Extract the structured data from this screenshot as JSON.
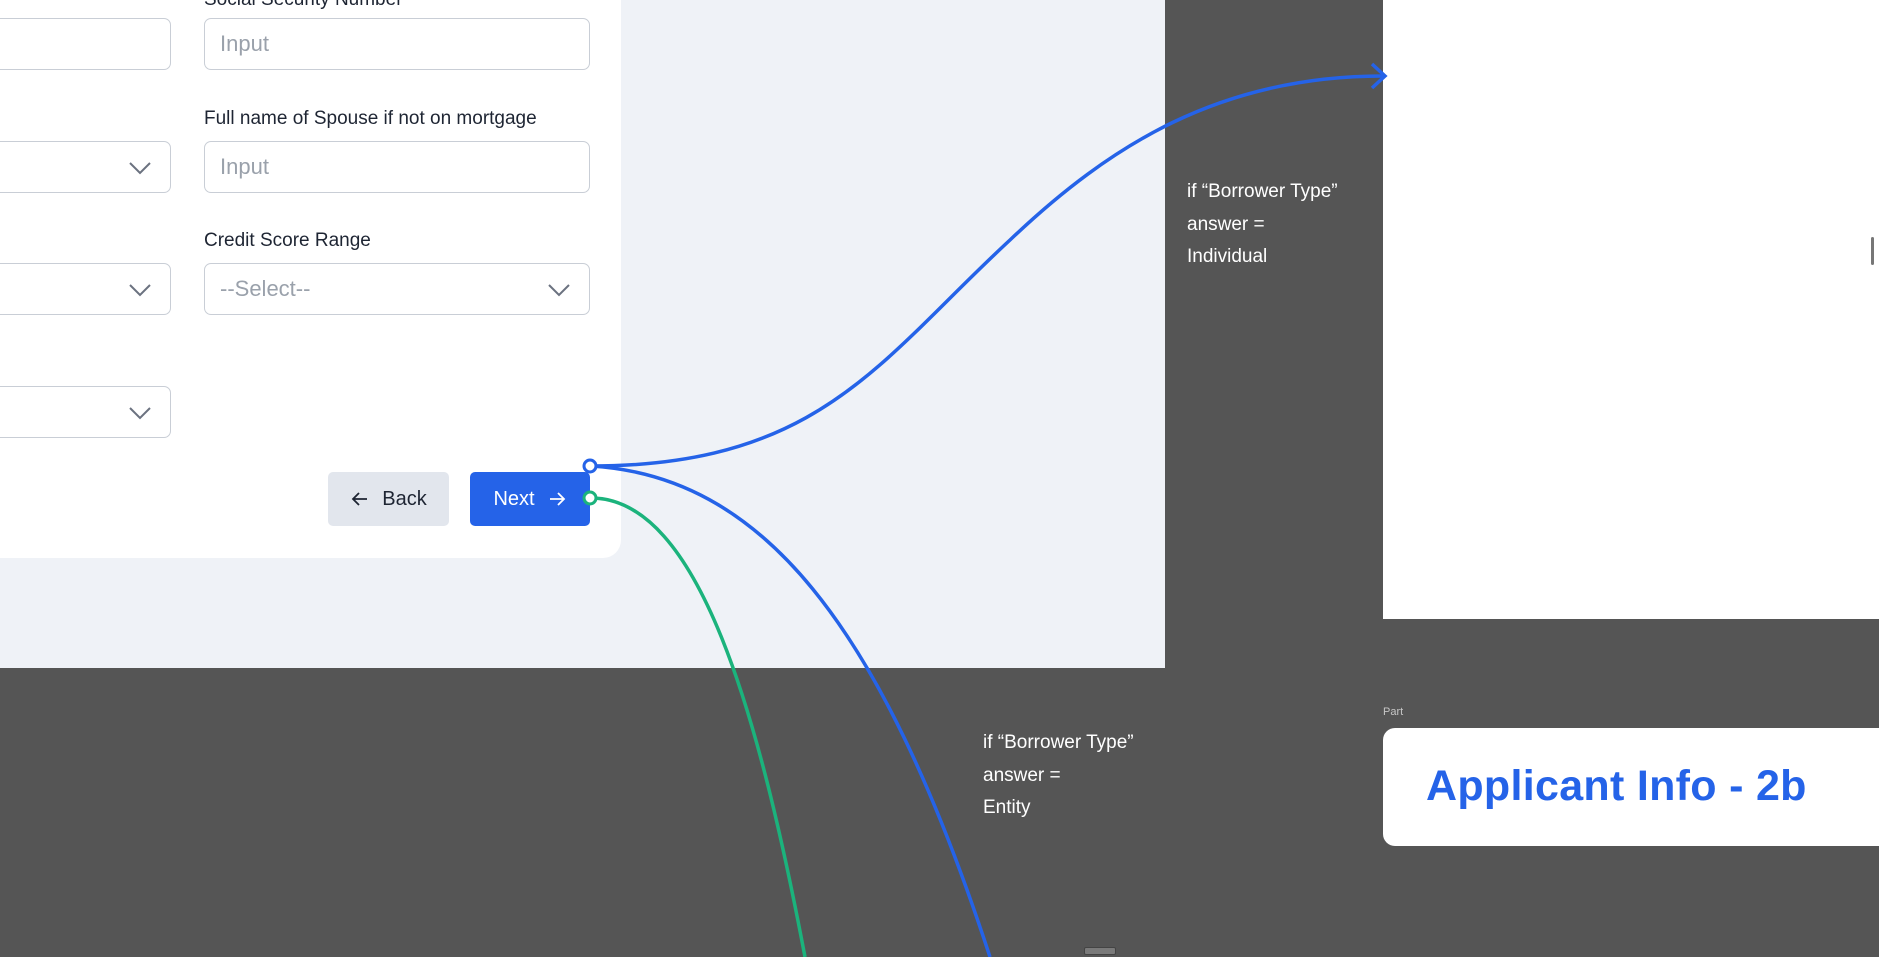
{
  "form": {
    "ssn_label": "Social Security Number",
    "ssn_placeholder": "Input",
    "spouse_label": "Full name of Spouse if not on mortgage",
    "spouse_placeholder": "Input",
    "credit_label": "Credit Score Range",
    "credit_value": "--Select--",
    "back_label": "Back",
    "next_label": "Next"
  },
  "notes": {
    "individual": "if “Borrower Type”\nanswer =\nIndividual",
    "entity": "if “Borrower Type”\nanswer =\nEntity"
  },
  "part": {
    "label": "Part",
    "title": "Applicant Info - 2b"
  },
  "colors": {
    "accent_blue": "#2563e8",
    "connector_green": "#1bb37c",
    "canvas_gray": "#555555"
  },
  "icons": [
    "chevron-down-icon",
    "arrow-left-icon",
    "arrow-right-icon",
    "arrow-head-icon"
  ]
}
